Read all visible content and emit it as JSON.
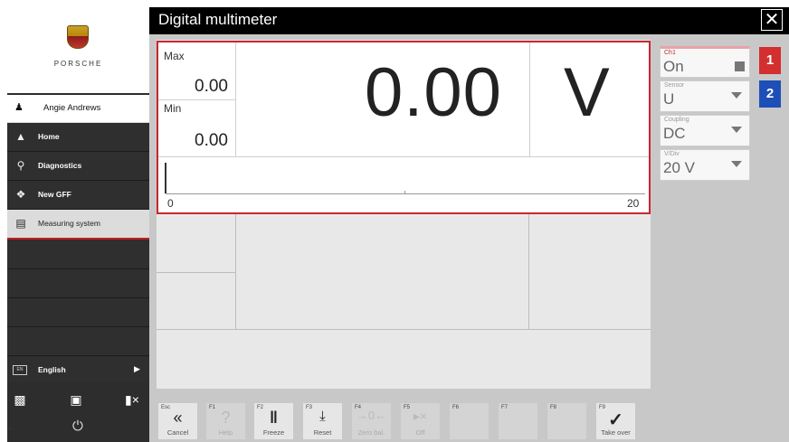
{
  "app": {
    "title": "Digital multimeter",
    "close_icon": "close-icon",
    "accent_color": "#c8272d",
    "channel2_color": "#1e4fb8"
  },
  "sidebar": {
    "brand": "PORSCHE",
    "user": "Angie Andrews",
    "items": [
      {
        "label": "Home",
        "icon": "home-icon"
      },
      {
        "label": "Diagnostics",
        "icon": "diagnostics-icon"
      },
      {
        "label": "New GFF",
        "icon": "guided-fault-finding-icon"
      },
      {
        "label": "Measuring system",
        "icon": "measuring-system-icon",
        "active": true
      }
    ],
    "language": "English",
    "language_icon_text": "EN",
    "power_icon": "power-icon"
  },
  "display": {
    "max_label": "Max",
    "max_value": "0.00",
    "min_label": "Min",
    "min_value": "0.00",
    "value": "0.00",
    "unit": "V",
    "scale_min": "0",
    "scale_max": "20"
  },
  "settings": {
    "channel": {
      "caption": "Ch1",
      "value": "On"
    },
    "sensor": {
      "caption": "Sensor",
      "value": "U"
    },
    "coupling": {
      "caption": "Coupling",
      "value": "DC"
    },
    "vdiv": {
      "caption": "V/Div",
      "value": "20 V"
    }
  },
  "channels": [
    "1",
    "2"
  ],
  "function_keys": [
    {
      "key": "Esc",
      "label": "Cancel",
      "icon": "double-chevron-left-icon",
      "enabled": true
    },
    {
      "key": "F1",
      "label": "Help",
      "icon": "question-icon",
      "enabled": false
    },
    {
      "key": "F2",
      "label": "Freeze",
      "icon": "pause-icon",
      "enabled": true
    },
    {
      "key": "F3",
      "label": "Reset",
      "icon": "reset-icon",
      "enabled": true
    },
    {
      "key": "F4",
      "label": "Zero bal.",
      "icon": "zero-balance-icon",
      "enabled": false
    },
    {
      "key": "F5",
      "label": "Off",
      "icon": "speaker-off-icon",
      "enabled": false
    },
    {
      "key": "F6",
      "label": "",
      "icon": "",
      "enabled": false
    },
    {
      "key": "F7",
      "label": "",
      "icon": "",
      "enabled": false
    },
    {
      "key": "F8",
      "label": "",
      "icon": "",
      "enabled": false
    },
    {
      "key": "F9",
      "label": "Take over",
      "icon": "checkmark-icon",
      "enabled": true
    }
  ]
}
